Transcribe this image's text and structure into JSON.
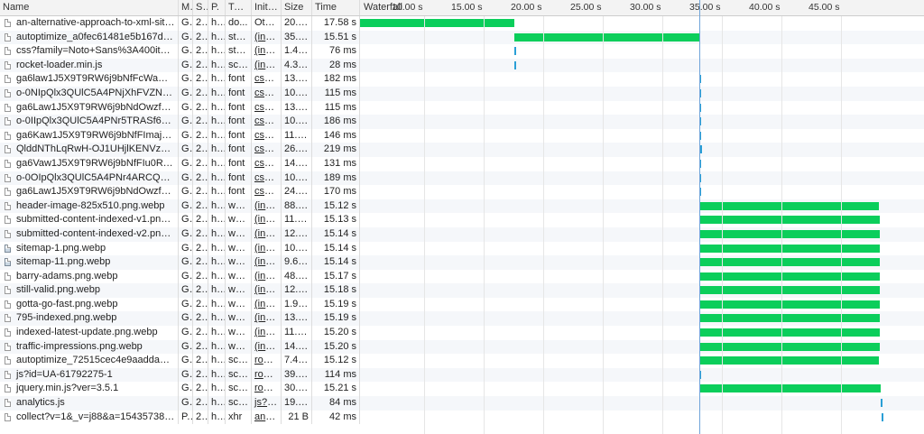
{
  "header": {
    "name": "Name",
    "method": "M.",
    "status": "S.",
    "protocol": "P.",
    "type": "Type",
    "initiator": "Initia...",
    "size": "Size",
    "time": "Time",
    "waterfall": "Waterfall"
  },
  "ticks": [
    "10.00 s",
    "15.00 s",
    "20.00 s",
    "25.00 s",
    "30.00 s",
    "35.00 s",
    "40.00 s",
    "45.00 s"
  ],
  "colors": {
    "bar": "#0bce5b",
    "bar_short": "#2a9fd6",
    "marker": "#6fa4d9"
  },
  "requests": [
    {
      "name": "an-alternative-approach-to-xml-sitemaps/",
      "m": "G...",
      "s": "2...",
      "p": "h...",
      "t": "do...",
      "i": "Other",
      "link": false,
      "size": "20.4 ...",
      "time": "17.58 s",
      "icon": "file-icon",
      "start": 0.0,
      "end": 17.58
    },
    {
      "name": "autoptimize_a0fec61481e5b167d990fee2...",
      "m": "G...",
      "s": "2...",
      "p": "h...",
      "t": "styl...",
      "i": "(index)",
      "link": true,
      "size": "35.7 ...",
      "time": "15.51 s",
      "icon": "file-icon",
      "start": 17.58,
      "end": 33.09
    },
    {
      "name": "css?family=Noto+Sans%3A400italic%2C7...",
      "m": "G...",
      "s": "2...",
      "p": "h...",
      "t": "styl...",
      "i": "(index)",
      "link": true,
      "size": "1.4 kB",
      "time": "76 ms",
      "icon": "file-icon",
      "start": 17.58,
      "end": 17.66
    },
    {
      "name": "rocket-loader.min.js",
      "m": "G...",
      "s": "2...",
      "p": "h2",
      "t": "scri...",
      "i": "(index)",
      "link": true,
      "size": "4.3 kB",
      "time": "28 ms",
      "icon": "file-icon",
      "start": 17.58,
      "end": 17.61
    },
    {
      "name": "ga6law1J5X9T9RW6j9bNfFcWaDq8fMU.w...",
      "m": "G...",
      "s": "2...",
      "p": "h...",
      "t": "font",
      "i": "css?f...",
      "link": true,
      "size": "13.2 ...",
      "time": "182 ms",
      "icon": "file-icon",
      "start": 33.09,
      "end": 33.27
    },
    {
      "name": "o-0NIpQlx3QUlC5A4PNjXhFVZNy8x2pqP...",
      "m": "G...",
      "s": "2...",
      "p": "h...",
      "t": "font",
      "i": "css?f...",
      "link": true,
      "size": "10.1 ...",
      "time": "115 ms",
      "icon": "file-icon",
      "start": 33.09,
      "end": 33.21
    },
    {
      "name": "ga6Law1J5X9T9RW6j9bNdOwzfReece9LO...",
      "m": "G...",
      "s": "2...",
      "p": "h...",
      "t": "font",
      "i": "css?f...",
      "link": true,
      "size": "13.7 ...",
      "time": "115 ms",
      "icon": "file-icon",
      "start": 33.09,
      "end": 33.21
    },
    {
      "name": "o-0IIpQlx3QUlC5A4PNr5TRASf6M7Q.woff2",
      "m": "G...",
      "s": "2...",
      "p": "h...",
      "t": "font",
      "i": "css?f...",
      "link": true,
      "size": "10.3 ...",
      "time": "186 ms",
      "icon": "file-icon",
      "start": 33.09,
      "end": 33.28
    },
    {
      "name": "ga6Kaw1J5X9T9RW6j9bNfFImajC7XsdBM...",
      "m": "G...",
      "s": "2...",
      "p": "h...",
      "t": "font",
      "i": "css?f...",
      "link": true,
      "size": "11.1 ...",
      "time": "146 ms",
      "icon": "file-icon",
      "start": 33.09,
      "end": 33.24
    },
    {
      "name": "QlddNThLqRwH-OJ1UHjlKENVzkWGVkL3...",
      "m": "G...",
      "s": "2...",
      "p": "h...",
      "t": "font",
      "i": "css?f...",
      "link": true,
      "size": "26.6 ...",
      "time": "219 ms",
      "icon": "file-icon",
      "start": 33.09,
      "end": 33.31
    },
    {
      "name": "ga6Vaw1J5X9T9RW6j9bNfFIu0RWuc-VMG...",
      "m": "G...",
      "s": "2...",
      "p": "h...",
      "t": "font",
      "i": "css?f...",
      "link": true,
      "size": "14.6 ...",
      "time": "131 ms",
      "icon": "file-icon",
      "start": 33.09,
      "end": 33.22
    },
    {
      "name": "o-0OIpQlx3QUlC5A4PNr4ARCQ_mu72Bi...",
      "m": "G...",
      "s": "2...",
      "p": "h...",
      "t": "font",
      "i": "css?f...",
      "link": true,
      "size": "10.0 ...",
      "time": "189 ms",
      "icon": "file-icon",
      "start": 33.09,
      "end": 33.28
    },
    {
      "name": "ga6Law1J5X9T9RW6j9bNdOwzfRmece9L...",
      "m": "G...",
      "s": "2...",
      "p": "h...",
      "t": "font",
      "i": "css?f...",
      "link": true,
      "size": "24.4 ...",
      "time": "170 ms",
      "icon": "file-icon",
      "start": 33.09,
      "end": 33.26
    },
    {
      "name": "header-image-825x510.png.webp",
      "m": "G...",
      "s": "2...",
      "p": "h...",
      "t": "we...",
      "i": "(inde...",
      "link": true,
      "size": "88.2 ...",
      "time": "15.12 s",
      "icon": "file-icon",
      "start": 33.09,
      "end": 48.21
    },
    {
      "name": "submitted-content-indexed-v1.png.webp",
      "m": "G...",
      "s": "2...",
      "p": "h...",
      "t": "we...",
      "i": "(inde...",
      "link": true,
      "size": "11.7 ...",
      "time": "15.13 s",
      "icon": "file-icon",
      "start": 33.09,
      "end": 48.22
    },
    {
      "name": "submitted-content-indexed-v2.png.webp",
      "m": "G...",
      "s": "2...",
      "p": "h...",
      "t": "we...",
      "i": "(inde...",
      "link": true,
      "size": "12.3 ...",
      "time": "15.14 s",
      "icon": "file-icon",
      "start": 33.09,
      "end": 48.23
    },
    {
      "name": "sitemap-1.png.webp",
      "m": "G...",
      "s": "2...",
      "p": "h...",
      "t": "we...",
      "i": "(inde...",
      "link": true,
      "size": "10.1 ...",
      "time": "15.14 s",
      "icon": "image-file-icon",
      "start": 33.09,
      "end": 48.23
    },
    {
      "name": "sitemap-11.png.webp",
      "m": "G...",
      "s": "2...",
      "p": "h...",
      "t": "we...",
      "i": "(inde...",
      "link": true,
      "size": "9.6 kB",
      "time": "15.14 s",
      "icon": "image-file-icon",
      "start": 33.09,
      "end": 48.23
    },
    {
      "name": "barry-adams.png.webp",
      "m": "G...",
      "s": "2...",
      "p": "h...",
      "t": "we...",
      "i": "(inde...",
      "link": true,
      "size": "48.3 ...",
      "time": "15.17 s",
      "icon": "file-icon",
      "start": 33.09,
      "end": 48.26
    },
    {
      "name": "still-valid.png.webp",
      "m": "G...",
      "s": "2...",
      "p": "h...",
      "t": "we...",
      "i": "(inde...",
      "link": true,
      "size": "12.0 ...",
      "time": "15.18 s",
      "icon": "file-icon",
      "start": 33.09,
      "end": 48.27
    },
    {
      "name": "gotta-go-fast.png.webp",
      "m": "G...",
      "s": "2...",
      "p": "h...",
      "t": "we...",
      "i": "(inde...",
      "link": true,
      "size": "1.9 kB",
      "time": "15.19 s",
      "icon": "file-icon",
      "start": 33.09,
      "end": 48.28
    },
    {
      "name": "795-indexed.png.webp",
      "m": "G...",
      "s": "2...",
      "p": "h...",
      "t": "we...",
      "i": "(inde...",
      "link": true,
      "size": "13.0 ...",
      "time": "15.19 s",
      "icon": "file-icon",
      "start": 33.09,
      "end": 48.28
    },
    {
      "name": "indexed-latest-update.png.webp",
      "m": "G...",
      "s": "2...",
      "p": "h...",
      "t": "we...",
      "i": "(inde...",
      "link": true,
      "size": "11.6 ...",
      "time": "15.20 s",
      "icon": "file-icon",
      "start": 33.09,
      "end": 48.29
    },
    {
      "name": "traffic-impressions.png.webp",
      "m": "G...",
      "s": "2...",
      "p": "h...",
      "t": "we...",
      "i": "(inde...",
      "link": true,
      "size": "14.5 ...",
      "time": "15.20 s",
      "icon": "file-icon",
      "start": 33.09,
      "end": 48.29
    },
    {
      "name": "autoptimize_72515cec4e9aadda4d16f5ea...",
      "m": "G...",
      "s": "2...",
      "p": "h...",
      "t": "scri...",
      "i": "rock...",
      "link": true,
      "size": "7.4 kB",
      "time": "15.12 s",
      "icon": "file-icon",
      "start": 33.09,
      "end": 48.21
    },
    {
      "name": "js?id=UA-61792275-1",
      "m": "G...",
      "s": "2...",
      "p": "h...",
      "t": "scri...",
      "i": "rock...",
      "link": true,
      "size": "39.5 ...",
      "time": "114 ms",
      "icon": "file-icon",
      "start": 33.09,
      "end": 33.2
    },
    {
      "name": "jquery.min.js?ver=3.5.1",
      "m": "G...",
      "s": "2...",
      "p": "h...",
      "t": "scri...",
      "i": "rock...",
      "link": true,
      "size": "30.9 ...",
      "time": "15.21 s",
      "icon": "file-icon",
      "start": 33.09,
      "end": 48.3
    },
    {
      "name": "analytics.js",
      "m": "G...",
      "s": "2...",
      "p": "h...",
      "t": "scri...",
      "i": "js?id...",
      "link": true,
      "size": "19.0 ...",
      "time": "84 ms",
      "icon": "file-icon",
      "start": 48.3,
      "end": 48.38
    },
    {
      "name": "collect?v=1&_v=j88&a=154357380&t=pa...",
      "m": "P...",
      "s": "2...",
      "p": "h...",
      "t": "xhr",
      "i": "analy...",
      "link": true,
      "size": "21 B",
      "time": "42 ms",
      "icon": "file-icon",
      "start": 48.4,
      "end": 48.44
    }
  ]
}
